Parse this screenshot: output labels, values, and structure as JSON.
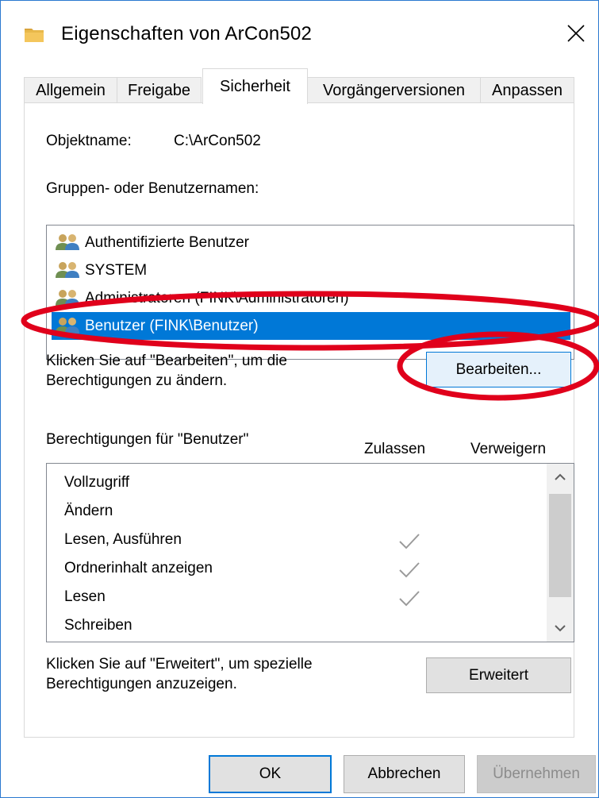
{
  "window": {
    "title": "Eigenschaften von ArCon502",
    "folder_icon": "folder-icon",
    "close_icon": "close-icon"
  },
  "tabs": [
    {
      "label": "Allgemein"
    },
    {
      "label": "Freigabe"
    },
    {
      "label": "Sicherheit",
      "active": true
    },
    {
      "label": "Vorgängerversionen"
    },
    {
      "label": "Anpassen"
    }
  ],
  "object": {
    "label": "Objektname:",
    "value": "C:\\ArCon502"
  },
  "groups": {
    "label": "Gruppen- oder Benutzernamen:",
    "items": [
      {
        "name": "Authentifizierte Benutzer",
        "icon": "users-icon"
      },
      {
        "name": "SYSTEM",
        "icon": "users-icon"
      },
      {
        "name": "Administratoren (FINK\\Administratoren)",
        "icon": "users-icon"
      },
      {
        "name": "Benutzer (FINK\\Benutzer)",
        "icon": "users-icon",
        "selected": true
      }
    ]
  },
  "edit": {
    "hint_line1": "Klicken Sie auf \"Bearbeiten\", um die",
    "hint_line2": "Berechtigungen zu ändern.",
    "button": "Bearbeiten..."
  },
  "permissions": {
    "label": "Berechtigungen für \"Benutzer\"",
    "col_allow": "Zulassen",
    "col_deny": "Verweigern",
    "rows": [
      {
        "name": "Vollzugriff",
        "allow": false
      },
      {
        "name": "Ändern",
        "allow": false
      },
      {
        "name": "Lesen, Ausführen",
        "allow": true
      },
      {
        "name": "Ordnerinhalt anzeigen",
        "allow": true
      },
      {
        "name": "Lesen",
        "allow": true
      },
      {
        "name": "Schreiben",
        "allow": false
      }
    ]
  },
  "advanced": {
    "hint_line1": "Klicken Sie auf \"Erweitert\", um spezielle",
    "hint_line2": "Berechtigungen anzuzeigen.",
    "button": "Erweitert"
  },
  "footer": {
    "ok": "OK",
    "cancel": "Abbrechen",
    "apply": "Übernehmen"
  },
  "colors": {
    "selection": "#0078d7",
    "annotation": "#e0001b",
    "check": "#9a9a9a"
  }
}
